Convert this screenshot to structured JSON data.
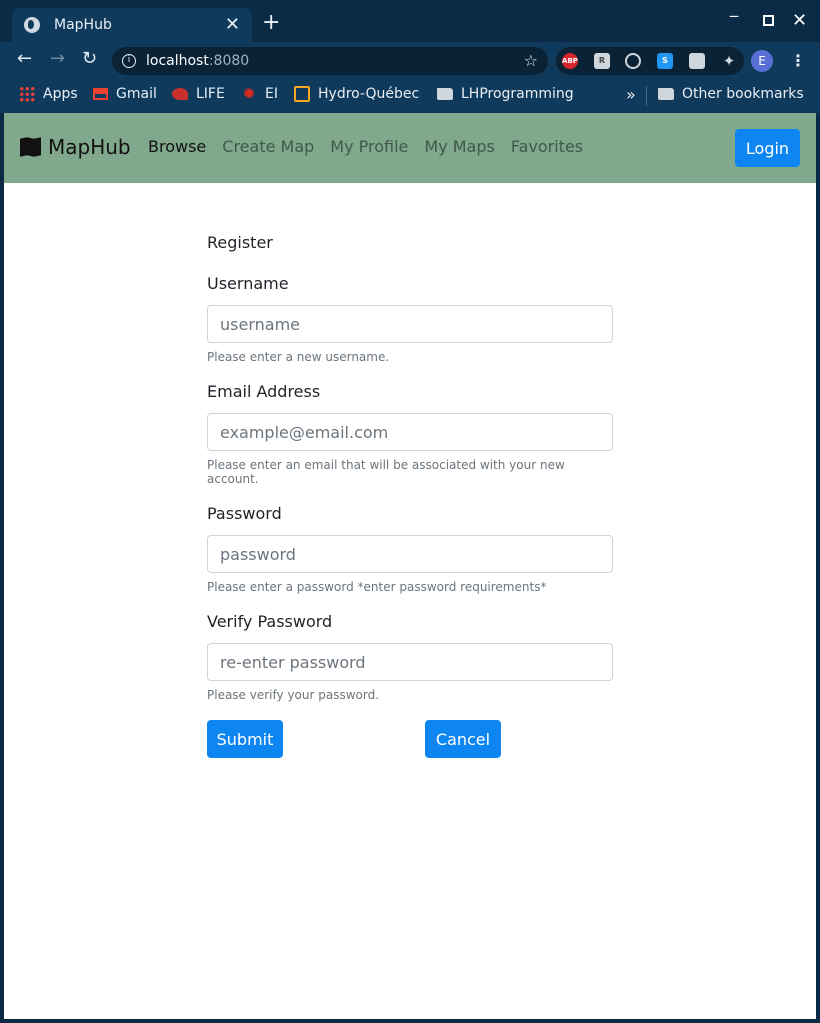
{
  "browser": {
    "tab_title": "MapHub",
    "url_host": "localhost",
    "url_port": ":8080",
    "profile_initial": "E",
    "extensions": [
      "ABP",
      "R",
      "",
      "S",
      "",
      ""
    ],
    "bookmarks": [
      {
        "label": "Apps",
        "icon": "apps-icon"
      },
      {
        "label": "Gmail",
        "icon": "gmail-icon"
      },
      {
        "label": "LIFE",
        "icon": "life-icon"
      },
      {
        "label": "EI",
        "icon": "maple-leaf-icon"
      },
      {
        "label": "Hydro-Québec",
        "icon": "hydro-quebec-icon"
      },
      {
        "label": "LHProgramming",
        "icon": "folder-icon"
      }
    ],
    "other_bookmarks": "Other bookmarks"
  },
  "navbar": {
    "brand": "MapHub",
    "links": [
      "Browse",
      "Create Map",
      "My Profile",
      "My Maps",
      "Favorites"
    ],
    "login": "Login"
  },
  "form": {
    "heading": "Register",
    "username": {
      "label": "Username",
      "placeholder": "username",
      "help": "Please enter a new username."
    },
    "email": {
      "label": "Email Address",
      "placeholder": "example@email.com",
      "help": "Please enter an email that will be associated with your new account."
    },
    "password": {
      "label": "Password",
      "placeholder": "password",
      "help": "Please enter a password *enter password requirements*"
    },
    "verify": {
      "label": "Verify Password",
      "placeholder": "re-enter password",
      "help": "Please verify your password."
    },
    "submit": "Submit",
    "cancel": "Cancel"
  },
  "colors": {
    "navbar_bg": "#80a88c",
    "primary": "#0d86f2",
    "chrome_bg": "#0f3a5c"
  }
}
